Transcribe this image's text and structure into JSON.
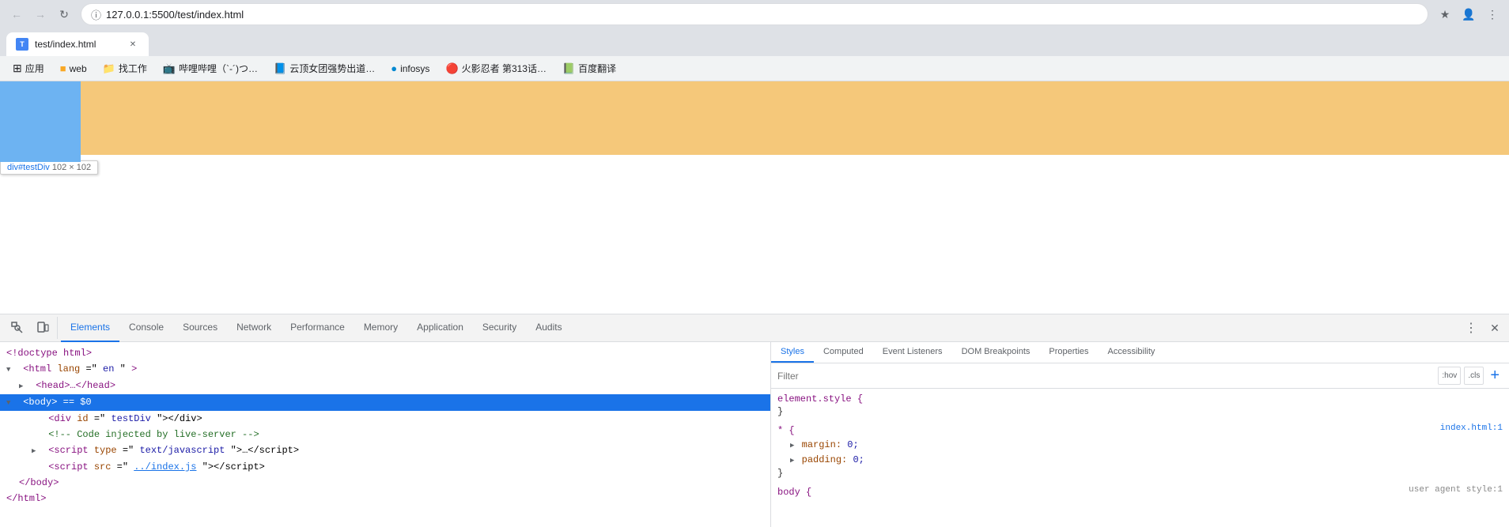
{
  "browser": {
    "url": "127.0.0.1:5500/test/index.html",
    "tab_title": "test/index.html"
  },
  "bookmarks": [
    {
      "id": "apps",
      "label": "应用",
      "icon": "⬛"
    },
    {
      "id": "web",
      "label": "web",
      "icon": "🔶"
    },
    {
      "id": "work",
      "label": "找工作",
      "icon": "📁"
    },
    {
      "id": "bibi",
      "label": "哔哩哔哩（`-´)つ…",
      "icon": "📺"
    },
    {
      "id": "yunshang",
      "label": "云顶女团强势出道…",
      "icon": "📘"
    },
    {
      "id": "infosys",
      "label": "infosys",
      "icon": "🔵"
    },
    {
      "id": "naruto",
      "label": "火影忍者 第313话…",
      "icon": "🔴"
    },
    {
      "id": "baidu",
      "label": "百度翻译",
      "icon": "📗"
    }
  ],
  "element_tooltip": {
    "selector": "div#testDiv",
    "size": "102 × 102"
  },
  "devtools": {
    "tabs": [
      "Elements",
      "Console",
      "Sources",
      "Network",
      "Performance",
      "Memory",
      "Application",
      "Security",
      "Audits"
    ]
  },
  "html_lines": [
    {
      "id": "doctype",
      "text": "<!doctype html>",
      "indent": 0,
      "type": "doctype"
    },
    {
      "id": "html-open",
      "text": "<html lang=\"en\">",
      "indent": 0,
      "type": "tag"
    },
    {
      "id": "head",
      "text": "<head>…</head>",
      "indent": 1,
      "type": "collapsed"
    },
    {
      "id": "body-open",
      "text": "<body> == $0",
      "indent": 0,
      "type": "selected"
    },
    {
      "id": "div-testDiv",
      "text": "<div id=\"testDiv\"></div>",
      "indent": 2,
      "type": "tag"
    },
    {
      "id": "comment",
      "text": "<!-- Code injected by live-server -->",
      "indent": 2,
      "type": "comment"
    },
    {
      "id": "script1",
      "text": "<script type=\"text/javascript\">…<\\/script>",
      "indent": 2,
      "type": "tag"
    },
    {
      "id": "script2",
      "text": "<script src=\"../index.js\"><\\/script>",
      "indent": 2,
      "type": "tag"
    },
    {
      "id": "body-close",
      "text": "</body>",
      "indent": 1,
      "type": "tag"
    },
    {
      "id": "html-close",
      "text": "</html>",
      "indent": 0,
      "type": "tag"
    }
  ],
  "styles": {
    "tabs": [
      "Styles",
      "Computed",
      "Event Listeners",
      "DOM Breakpoints",
      "Properties",
      "Accessibility"
    ],
    "active_tab": "Styles",
    "filter_placeholder": "Filter",
    "filter_buttons": [
      ":hov",
      ".cls",
      "+"
    ],
    "rules": [
      {
        "selector": "element.style {",
        "props": [],
        "close": "}",
        "source": ""
      },
      {
        "selector": "* {",
        "props": [
          {
            "name": "margin:",
            "value": "▶ 0;"
          },
          {
            "name": "padding:",
            "value": "▶ 0;"
          }
        ],
        "close": "}",
        "source": "index.html:1"
      },
      {
        "selector": "body {",
        "props": [],
        "close": "",
        "source": "user agent style:1"
      }
    ]
  }
}
